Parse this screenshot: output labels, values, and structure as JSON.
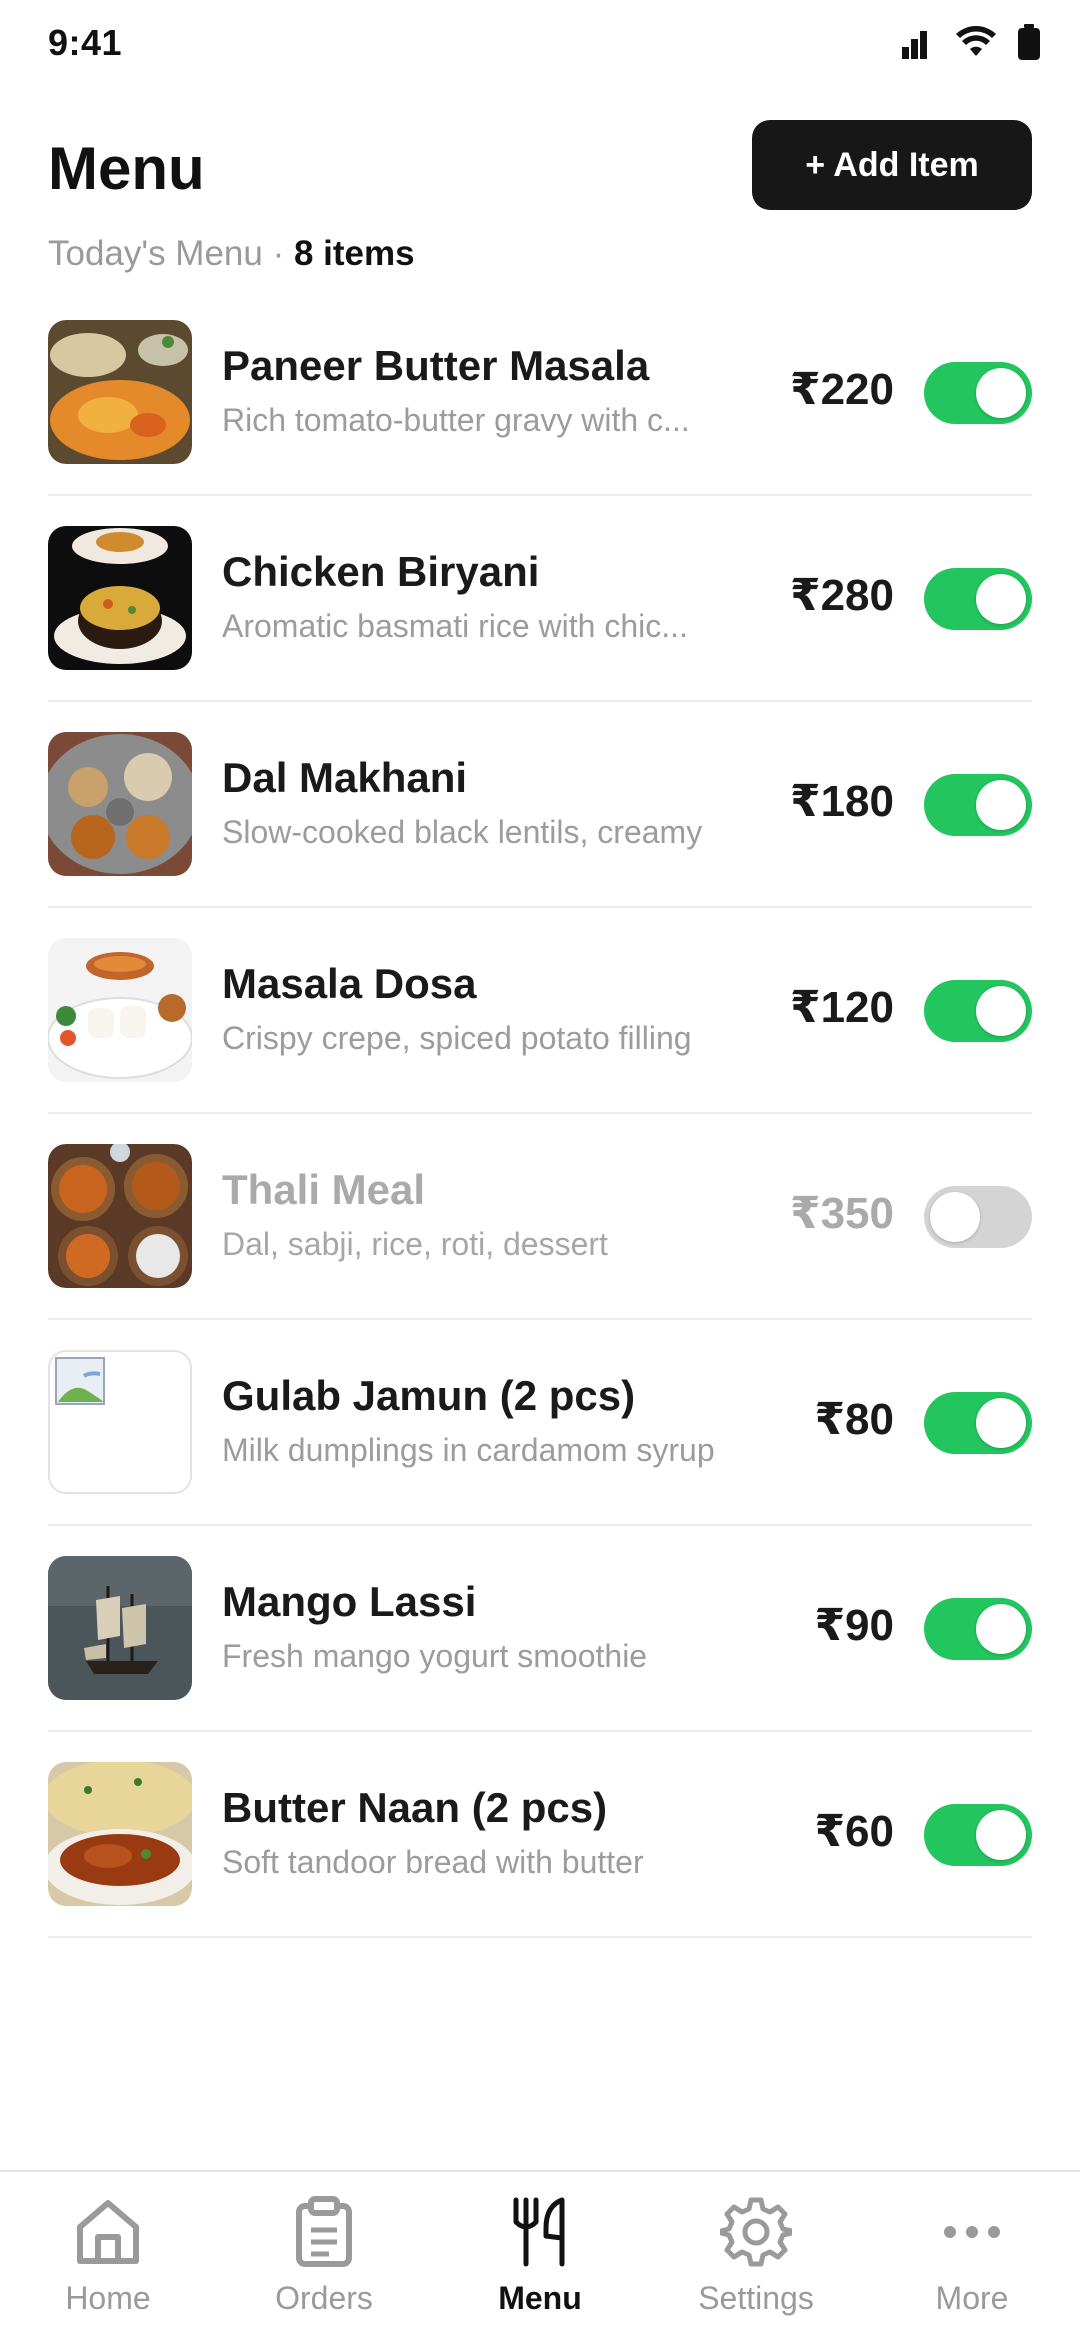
{
  "status": {
    "time": "9:41"
  },
  "header": {
    "title": "Menu",
    "add_button_label": "+ Add Item"
  },
  "subtitle": {
    "prefix": "Today's Menu · ",
    "count": "8 items"
  },
  "items": [
    {
      "name": "Paneer Butter Masala",
      "description": "Rich tomato-butter gravy with c...",
      "price": "₹220",
      "available": true
    },
    {
      "name": "Chicken Biryani",
      "description": "Aromatic basmati rice with chic...",
      "price": "₹280",
      "available": true
    },
    {
      "name": "Dal Makhani",
      "description": "Slow-cooked black lentils, creamy",
      "price": "₹180",
      "available": true
    },
    {
      "name": "Masala Dosa",
      "description": "Crispy crepe, spiced potato filling",
      "price": "₹120",
      "available": true
    },
    {
      "name": "Thali Meal",
      "description": "Dal, sabji, rice, roti, dessert",
      "price": "₹350",
      "available": false
    },
    {
      "name": "Gulab Jamun (2 pcs)",
      "description": "Milk dumplings in cardamom syrup",
      "price": "₹80",
      "available": true
    },
    {
      "name": "Mango Lassi",
      "description": "Fresh mango yogurt smoothie",
      "price": "₹90",
      "available": true
    },
    {
      "name": "Butter Naan (2 pcs)",
      "description": "Soft tandoor bread with butter",
      "price": "₹60",
      "available": true
    }
  ],
  "nav": [
    {
      "label": "Home",
      "icon": "home-icon",
      "active": false
    },
    {
      "label": "Orders",
      "icon": "clipboard-icon",
      "active": false
    },
    {
      "label": "Menu",
      "icon": "fork-knife-icon",
      "active": true
    },
    {
      "label": "Settings",
      "icon": "gear-icon",
      "active": false
    },
    {
      "label": "More",
      "icon": "more-dots-icon",
      "active": false
    }
  ],
  "colors": {
    "toggle_on": "#22c55e",
    "toggle_off": "#d4d4d4",
    "button_bg": "#171717"
  }
}
